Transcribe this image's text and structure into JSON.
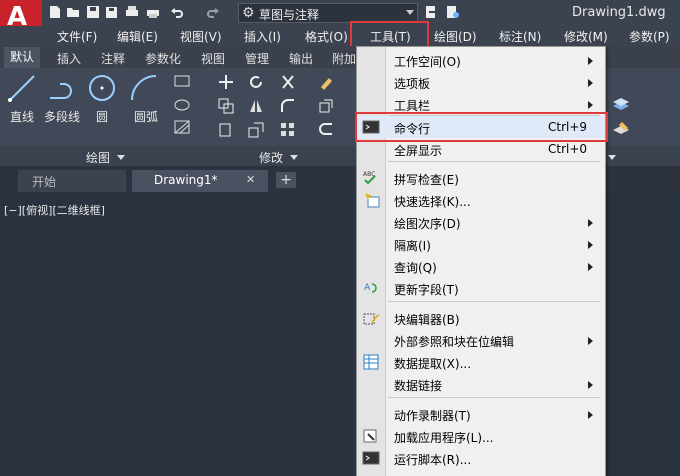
{
  "window": {
    "doc_title": "Drawing1.dwg"
  },
  "workspace": {
    "name": "草图与注释"
  },
  "menubar": {
    "items": [
      "文件(F)",
      "编辑(E)",
      "视图(V)",
      "插入(I)",
      "格式(O)",
      "工具(T)",
      "绘图(D)",
      "标注(N)",
      "修改(M)",
      "参数(P)"
    ]
  },
  "ribbon": {
    "tabs": [
      "默认",
      "插入",
      "注释",
      "参数化",
      "视图",
      "管理",
      "输出",
      "附加"
    ],
    "draw_tools": [
      "直线",
      "多段线",
      "圆",
      "圆弧"
    ],
    "panels": {
      "draw": "绘图",
      "modify": "修改"
    }
  },
  "file_tabs": {
    "start": "开始",
    "drawing": "Drawing1*",
    "close": "✕",
    "add": "+"
  },
  "viewport_label": "[−][俯视][二维线框]",
  "tools_menu": {
    "items": [
      {
        "label": "工作空间(O)"
      },
      {
        "label": "选项板"
      },
      {
        "label": "工具栏"
      },
      {
        "label": "命令行",
        "shortcut": "Ctrl+9"
      },
      {
        "label": "全屏显示",
        "shortcut": "Ctrl+0"
      },
      {
        "label": "拼写检查(E)"
      },
      {
        "label": "快速选择(K)..."
      },
      {
        "label": "绘图次序(D)"
      },
      {
        "label": "隔离(I)"
      },
      {
        "label": "查询(Q)"
      },
      {
        "label": "更新字段(T)"
      },
      {
        "label": "块编辑器(B)"
      },
      {
        "label": "外部参照和块在位编辑"
      },
      {
        "label": "数据提取(X)..."
      },
      {
        "label": "数据链接"
      },
      {
        "label": "动作录制器(T)"
      },
      {
        "label": "加载应用程序(L)..."
      },
      {
        "label": "运行脚本(R)..."
      }
    ]
  },
  "colors": {
    "highlight": "#e0393c",
    "accent": "#c8232b"
  }
}
